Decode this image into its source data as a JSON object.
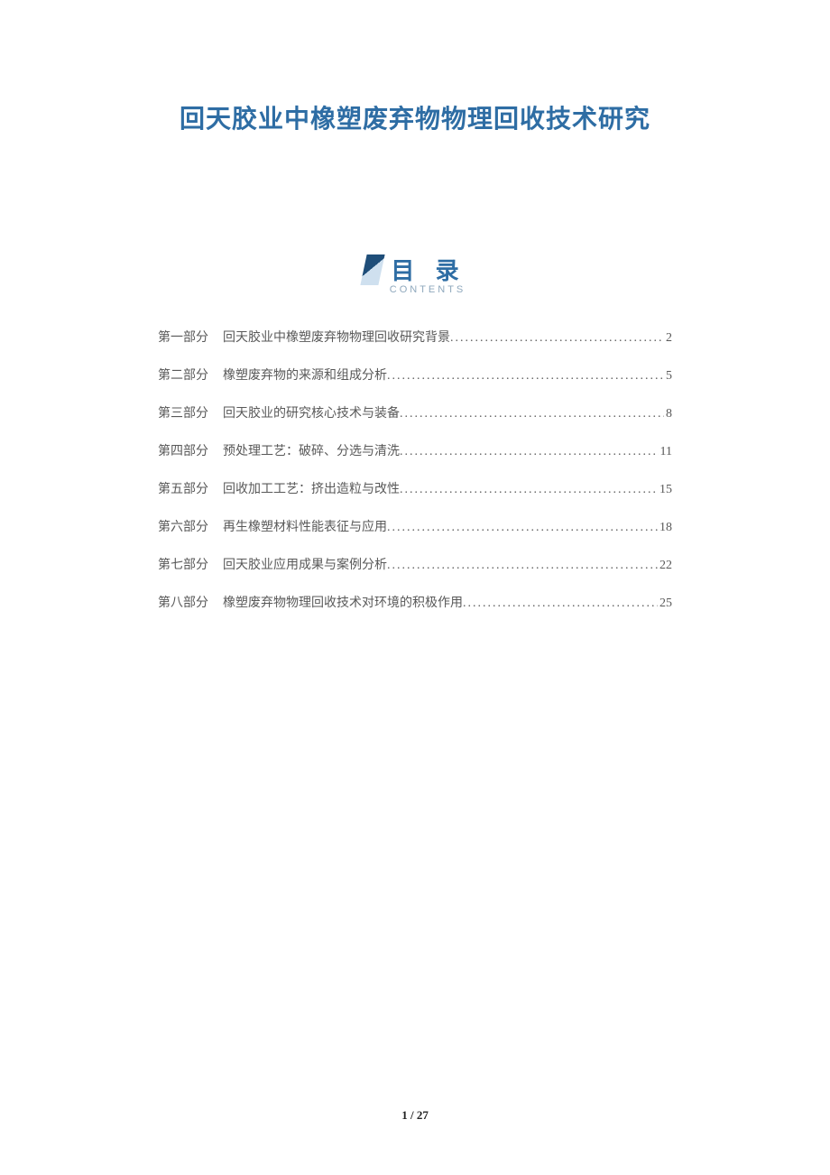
{
  "title": "回天胶业中橡塑废弃物物理回收技术研究",
  "toc": {
    "label_cn": "目 录",
    "label_en": "CONTENTS",
    "items": [
      {
        "part": "第一部分",
        "entry": "回天胶业中橡塑废弃物物理回收研究背景",
        "page": "2"
      },
      {
        "part": "第二部分",
        "entry": "橡塑废弃物的来源和组成分析",
        "page": "5"
      },
      {
        "part": "第三部分",
        "entry": "回天胶业的研究核心技术与装备",
        "page": "8"
      },
      {
        "part": "第四部分",
        "entry": "预处理工艺：破碎、分选与清洗",
        "page": "11"
      },
      {
        "part": "第五部分",
        "entry": "回收加工工艺：挤出造粒与改性",
        "page": "15"
      },
      {
        "part": "第六部分",
        "entry": "再生橡塑材料性能表征与应用",
        "page": "18"
      },
      {
        "part": "第七部分",
        "entry": "回天胶业应用成果与案例分析",
        "page": "22"
      },
      {
        "part": "第八部分",
        "entry": "橡塑废弃物物理回收技术对环境的积极作用",
        "page": "25"
      }
    ]
  },
  "footer": {
    "current": "1",
    "sep": " / ",
    "total": "27"
  }
}
